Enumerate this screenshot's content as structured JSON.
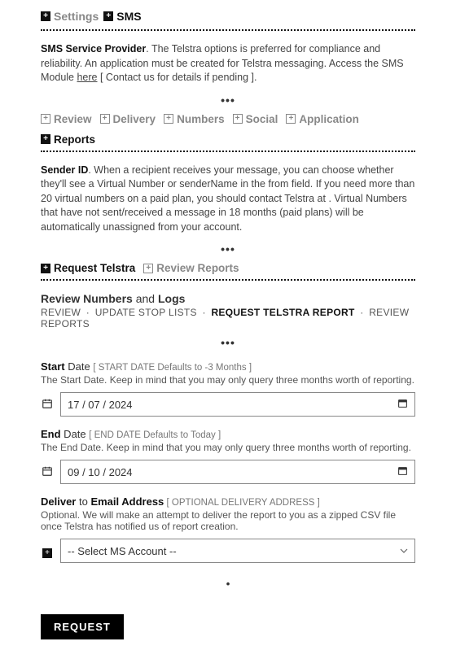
{
  "breadcrumb": {
    "settings": "Settings",
    "sms": "SMS"
  },
  "intro": {
    "lead": "SMS Service Provider",
    "body1": ". The Telstra options is preferred for compliance and reliability. An application must be created for Telstra messaging. Access the SMS Module ",
    "link": "here",
    "body2": " [ Contact us for details if pending ]."
  },
  "tabs": {
    "review": "Review",
    "delivery": "Delivery",
    "numbers": "Numbers",
    "social": "Social",
    "application": "Application",
    "reports": "Reports"
  },
  "sender": {
    "lead": "Sender ID",
    "body": ". When a recipient receives your message, you can choose whether they'll see a Virtual Number or senderName in the from field. If you need more than 20 virtual numbers on a paid plan, you should contact Telstra at . Virtual Numbers that have not sent/received a message in 18 months (paid plans) will be automatically unassigned from your account."
  },
  "subtabs": {
    "request": "Request Telstra",
    "review": "Review Reports"
  },
  "section": {
    "title_pre": "Review Numbers",
    "title_mid": " and ",
    "title_post": "Logs",
    "crumb_review": "REVIEW",
    "crumb_update": "UPDATE STOP LISTS",
    "crumb_request": "REQUEST TELSTRA REPORT",
    "crumb_reports": "REVIEW REPORTS"
  },
  "fields": {
    "start_label_b": "Start",
    "start_label": " Date ",
    "start_hint": "[ START DATE Defaults to -3 Months ]",
    "start_help": "The Start Date. Keep in mind that you may only query three months worth of reporting.",
    "start_value": "17 / 07 / 2024",
    "end_label_b": "End",
    "end_label": " Date ",
    "end_hint": "[ END DATE Defaults to Today ]",
    "end_help": "The End Date. Keep in mind that you may only query three months worth of reporting.",
    "end_value": "09 / 10 / 2024",
    "deliver_label_b": "Deliver",
    "deliver_label_mid": " to ",
    "deliver_label_b2": "Email Address",
    "deliver_hint": " [ OPTIONAL DELIVERY ADDRESS ]",
    "deliver_help": "Optional. We will make an attempt to deliver the report to you as a zipped CSV file once Telstra has notified us of report creation.",
    "deliver_value": "-- Select MS Account --"
  },
  "button": {
    "request": "REQUEST"
  },
  "sep": {
    "dots": "•••",
    "dot": "•",
    "pipe": " · "
  }
}
